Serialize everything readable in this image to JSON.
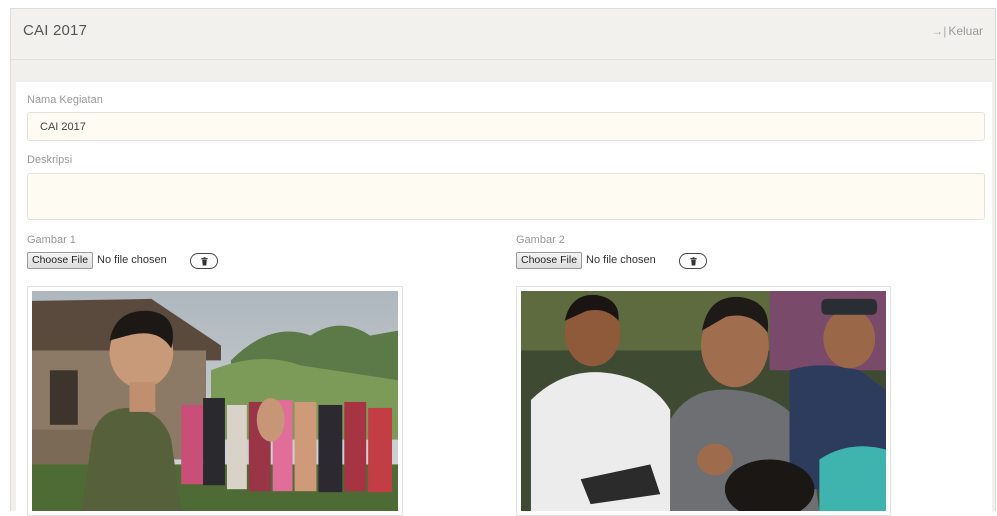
{
  "header": {
    "title": "CAI 2017",
    "logout_label": "Keluar",
    "logout_icon": "sign-out-icon"
  },
  "form": {
    "name": {
      "label": "Nama Kegiatan",
      "value": "CAI 2017"
    },
    "description": {
      "label": "Deskripsi",
      "value": ""
    },
    "images": [
      {
        "label": "Gambar 1",
        "choose_label": "Choose File",
        "status": "No file chosen",
        "delete_icon": "trash-icon"
      },
      {
        "label": "Gambar 2",
        "choose_label": "Choose File",
        "status": "No file chosen",
        "delete_icon": "trash-icon"
      }
    ]
  }
}
